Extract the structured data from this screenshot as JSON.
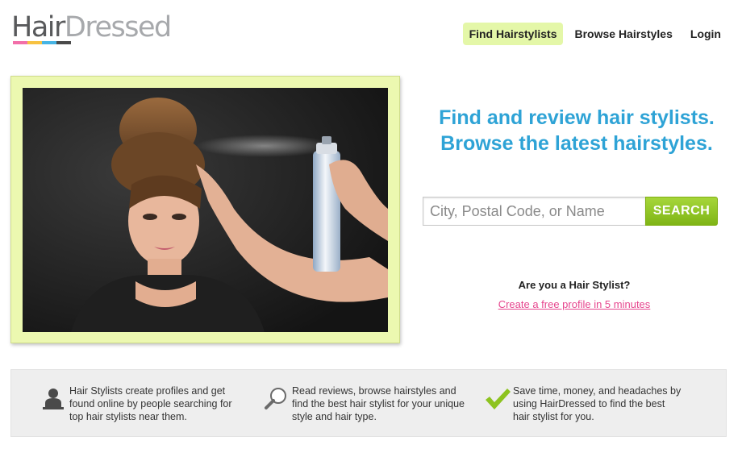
{
  "brand": {
    "logo_part1": "Hair",
    "logo_part2": "Dressed",
    "colors": {
      "hair": "#58595b",
      "dressed": "#a7a9ac",
      "bar": [
        "#f26fa9",
        "#f7c241",
        "#46b4e4",
        "#4a4a4a"
      ]
    }
  },
  "nav": {
    "items": [
      {
        "label": "Find Hairstylists",
        "active": true
      },
      {
        "label": "Browse Hairstyles",
        "active": false
      },
      {
        "label": "Login",
        "active": false
      }
    ]
  },
  "hero": {
    "headline_line1": "Find and review hair stylists.",
    "headline_line2": "Browse the latest hairstyles.",
    "accent_color": "#2ea3d6"
  },
  "search": {
    "placeholder": "City, Postal Code, or Name",
    "value": "",
    "button_label": "SEARCH",
    "button_color": "#8dc31f"
  },
  "stylist_cta": {
    "question": "Are you a Hair Stylist?",
    "link_label": "Create a free profile in 5 minutes",
    "link_color": "#e6468e"
  },
  "features": [
    {
      "icon": "person-silhouette-icon",
      "text": "Hair Stylists create profiles and get found online by people searching for top hair stylists near them."
    },
    {
      "icon": "magnifier-icon",
      "text": "Read reviews, browse hairstyles and find the best hair stylist for your unique style and hair type."
    },
    {
      "icon": "checkmark-icon",
      "text": "Save time, money, and headaches by using HairDressed to find the best hair stylist for you."
    }
  ]
}
